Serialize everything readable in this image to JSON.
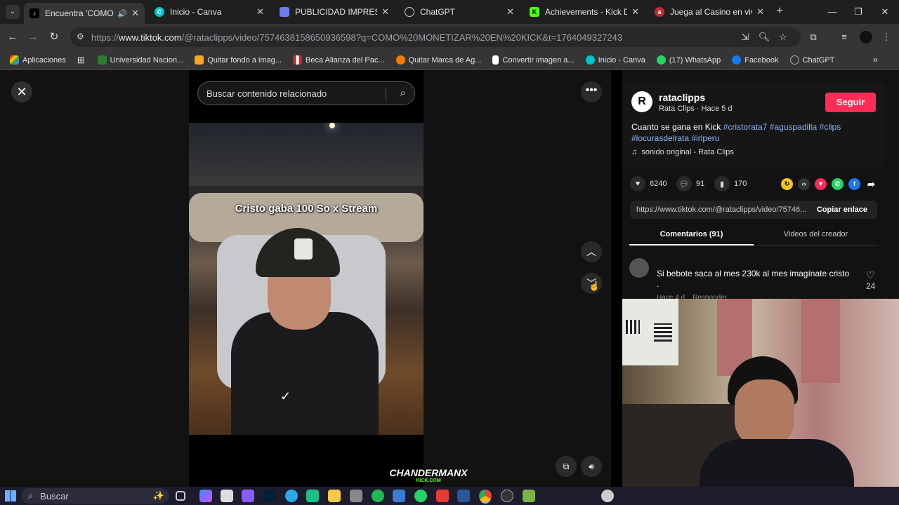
{
  "browser": {
    "tabs": [
      {
        "title": "Encuentra 'COMO MO",
        "active": true
      },
      {
        "title": "Inicio - Canva"
      },
      {
        "title": "PUBLICIDAD IMPRESIÓN -"
      },
      {
        "title": "ChatGPT"
      },
      {
        "title": "Achievements - Kick Dashb"
      },
      {
        "title": "Juega al Casino en vivo Or"
      }
    ],
    "url_prefix": "https://",
    "url_host": "www.tiktok.com",
    "url_rest": "/@rataclipps/video/7574638158650936598?q=COMO%20MONETIZAR%20EN%20KICK&t=1764049327243",
    "bookmarks": [
      {
        "label": "Aplicaciones",
        "color": "#4285f4"
      },
      {
        "label": "Universidad Nacion...",
        "color": "#2e7d32"
      },
      {
        "label": "Quitar fondo a imag...",
        "color": "#f9a825"
      },
      {
        "label": "Beca Alianza del Pac...",
        "color": "#c62828"
      },
      {
        "label": "Quitar Marca de Ag...",
        "color": "#f57c00"
      },
      {
        "label": "Convertir imagen a...",
        "color": "#ffffff"
      },
      {
        "label": "Inicio - Canva",
        "color": "#00c4cc"
      },
      {
        "label": "(17) WhatsApp",
        "color": "#25d366"
      },
      {
        "label": "Facebook",
        "color": "#1877f2"
      },
      {
        "label": "ChatGPT",
        "color": "#aaaaaa"
      }
    ]
  },
  "tiktok": {
    "search_placeholder": "Buscar contenido relacionado",
    "video_caption": "Cristo gaba 100 So x Stream",
    "watermark_name": "CHANDERMANX",
    "watermark_sub": "KICK.COM",
    "author": {
      "avatar_letter": "R",
      "username": "rataclipps",
      "meta": "Rata Clips · Hace 5 d",
      "follow_label": "Seguir"
    },
    "description_text": "Cuanto se gana en Kick",
    "hashtags_line1": "#cristorata7 #aguspadilla #clips",
    "hashtags_line2": "#locurasdelrata #irlperu",
    "sound": "sonido original - Rata Clips",
    "likes": "6240",
    "comments": "91",
    "saves": "170",
    "link": "https://www.tiktok.com/@rataclipps/video/75746...",
    "copy_label": "Copiar enlace",
    "tab_comments": "Comentarios (91)",
    "tab_creator": "Videos del creador",
    "comment": {
      "text": "Si bebote saca al mes 230k al mes imagínate cristo",
      "text2": ".",
      "meta": "Hace 4 d    Responder",
      "likes": "24"
    }
  },
  "taskbar": {
    "search_label": "Buscar"
  }
}
